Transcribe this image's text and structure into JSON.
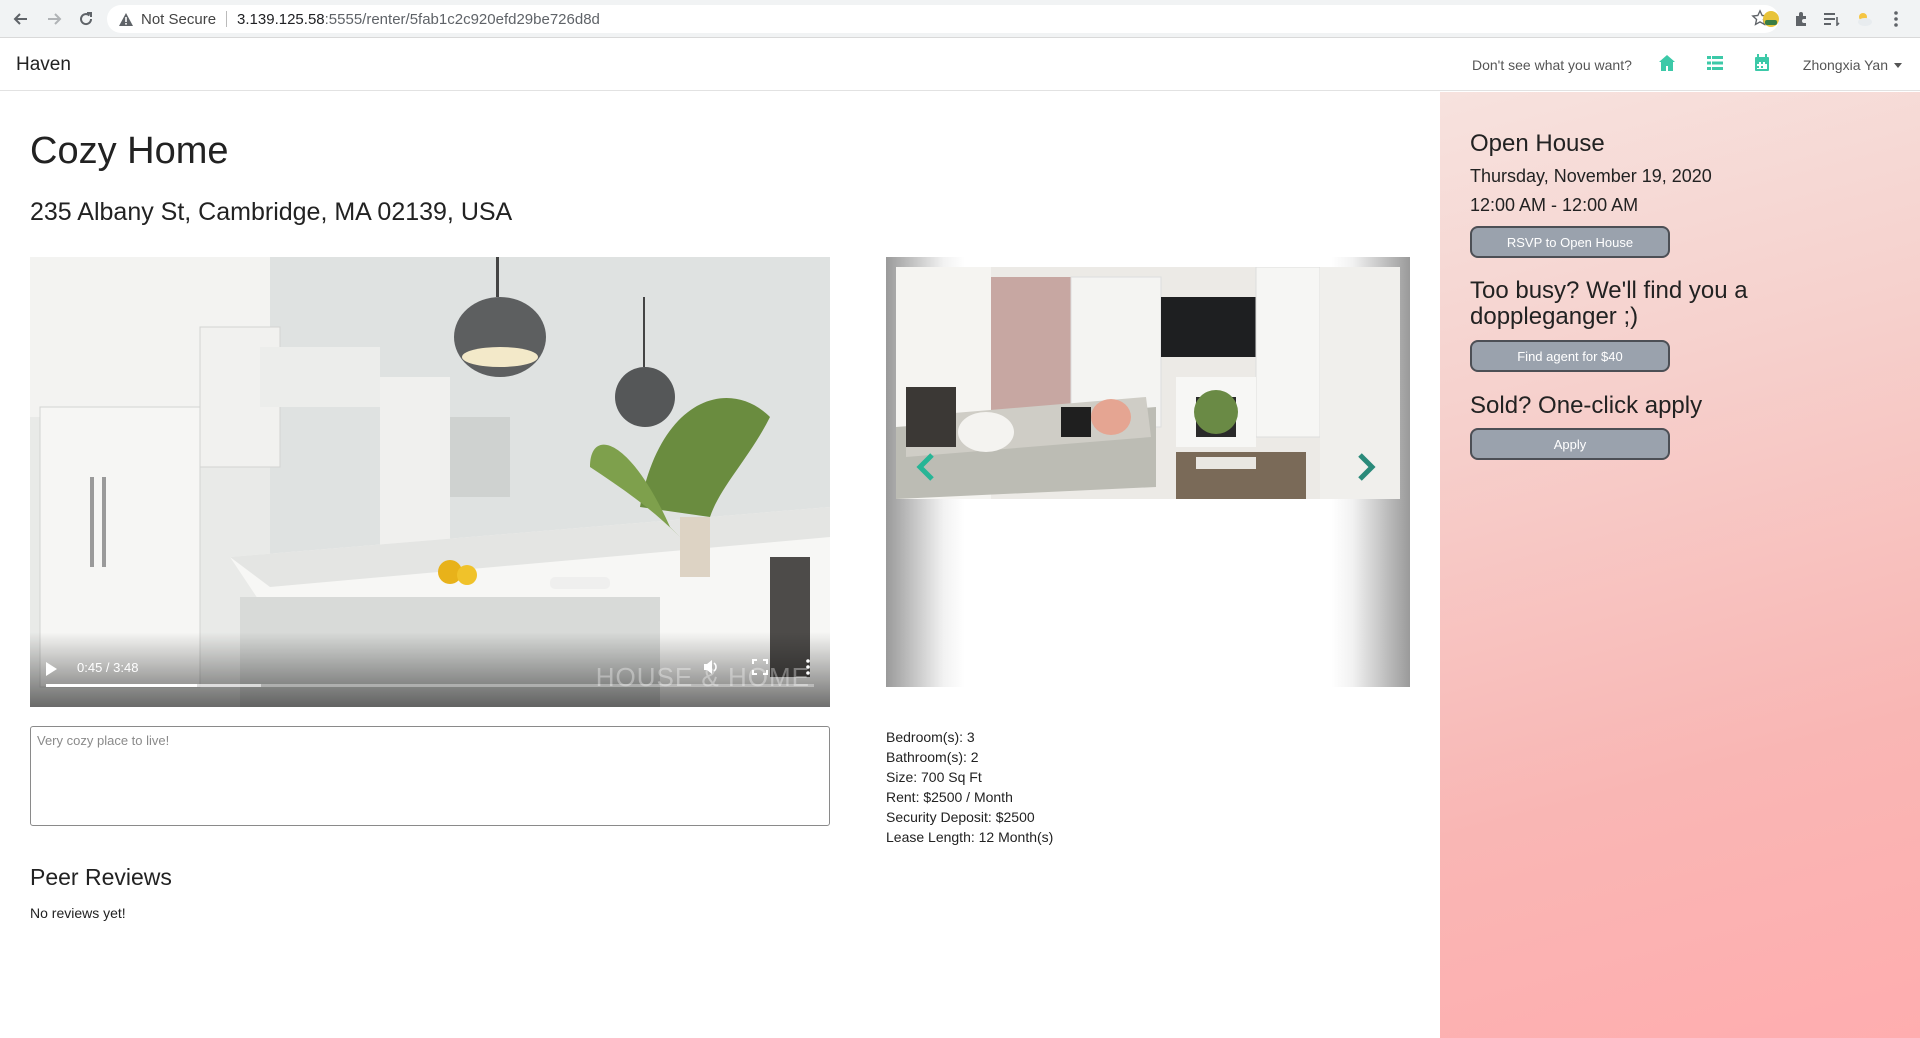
{
  "browser": {
    "security_label": "Not Secure",
    "url_host": "3.139.125.58",
    "url_path": ":5555/renter/5fab1c2c920efd29be726d8d"
  },
  "navbar": {
    "brand": "Haven",
    "link_text": "Don't see what you want?",
    "icons": [
      "home-icon",
      "list-icon",
      "calendar-icon"
    ],
    "user_name": "Zhongxia Yan",
    "accent_color": "#3cc9a8"
  },
  "listing": {
    "title": "Cozy Home",
    "address": "235 Albany St, Cambridge, MA 02139, USA",
    "video": {
      "time_display": "0:45 / 3:48",
      "played_fraction": 0.196,
      "buffered_fraction": 0.28,
      "watermark": "HOUSE & HOME"
    },
    "description_placeholder": "Very cozy place to live!",
    "details": [
      "Bedroom(s): 3",
      "Bathroom(s): 2",
      "Size: 700 Sq Ft",
      "Rent: $2500 / Month",
      "Security Deposit: $2500",
      "Lease Length: 12 Month(s)"
    ]
  },
  "reviews": {
    "title": "Peer Reviews",
    "empty_text": "No reviews yet!"
  },
  "sidebar": {
    "open_house_title": "Open House",
    "open_house_date": "Thursday, November 19, 2020",
    "open_house_time": "12:00 AM - 12:00 AM",
    "rsvp_label": "RSVP to Open House",
    "busy_title": "Too busy? We'll find you a doppleganger ;)",
    "agent_label": "Find agent for $40",
    "sold_title": "Sold? One-click apply",
    "apply_label": "Apply"
  }
}
